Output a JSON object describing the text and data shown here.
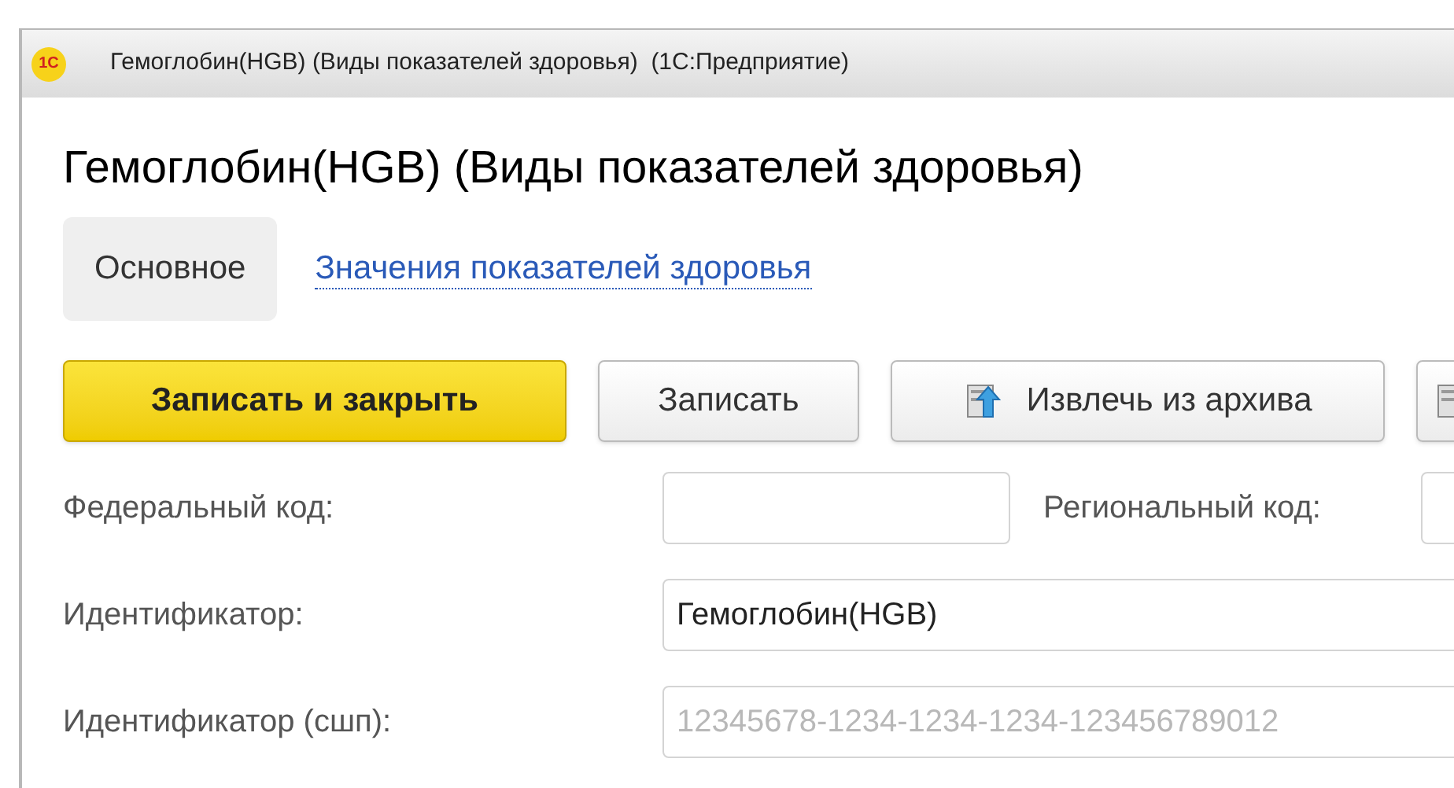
{
  "window": {
    "title": "Гемоглобин(HGB) (Виды показателей здоровья)  (1С:Предприятие)",
    "logo": "1С"
  },
  "heading": "Гемоглобин(HGB) (Виды показателей здоровья)",
  "tabs": [
    {
      "label": "Основное",
      "selected": true
    },
    {
      "label": "Значения показателей здоровья",
      "selected": false
    }
  ],
  "buttons": [
    {
      "kind": "default",
      "label": "Записать и закрыть"
    },
    {
      "kind": "plain",
      "label": "Записать"
    },
    {
      "kind": "archive",
      "label": "Извлечь из архива"
    },
    {
      "kind": "icon"
    }
  ],
  "fields": [
    {
      "label": "Федеральный код:",
      "second_label": "Региональный код:"
    },
    {
      "label": "Идентификатор:",
      "value": "Гемоглобин(HGB)"
    },
    {
      "label": "Идентификатор (сшп):",
      "placeholder": "12345678-1234-1234-1234-123456789012"
    }
  ]
}
